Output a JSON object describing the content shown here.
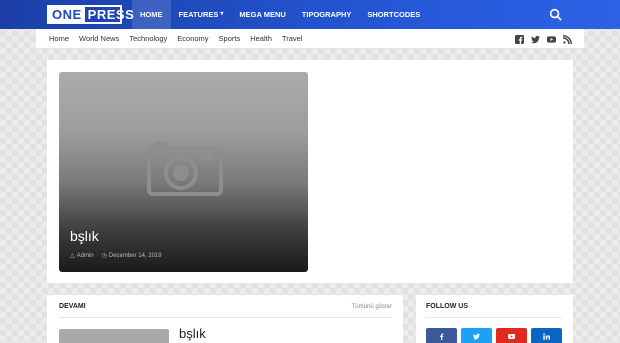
{
  "header": {
    "logo_left": "ONE",
    "logo_right": "PRESS",
    "nav": [
      {
        "label": "Home"
      },
      {
        "label": "Features"
      },
      {
        "label": "Mega Menu"
      },
      {
        "label": "Tipography"
      },
      {
        "label": "Shortcodes"
      }
    ]
  },
  "subnav": {
    "items": [
      "Home",
      "World News",
      "Technology",
      "Economy",
      "Sports",
      "Health",
      "Travel"
    ],
    "social_icons": [
      "facebook-icon",
      "twitter-icon",
      "youtube-icon",
      "rss-icon"
    ]
  },
  "featured": {
    "title": "bşlık",
    "author": "Admin",
    "date": "December 14, 2019"
  },
  "devami": {
    "heading": "DEVAMI",
    "more": "Tümünü göster",
    "post_title": "bşlık"
  },
  "follow": {
    "heading": "FOLLOW US",
    "buttons": [
      {
        "icon": "facebook-icon",
        "color": "#3b5998"
      },
      {
        "icon": "twitter-icon",
        "color": "#1da1f2"
      },
      {
        "icon": "youtube-icon",
        "color": "#e02a20"
      },
      {
        "icon": "linkedin-icon",
        "color": "#0a66c2"
      }
    ]
  },
  "colors": {
    "brand": "#2456d4",
    "brand_dark": "#1b3fa6"
  }
}
